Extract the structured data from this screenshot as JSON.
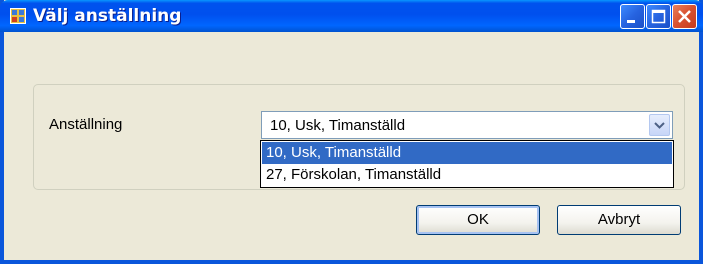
{
  "window": {
    "title": "Välj anställning",
    "buttons": [
      "minimize-icon",
      "maximize-icon",
      "close-icon"
    ],
    "colors": {
      "titlebar": "#0053EE",
      "close": "#D8502F",
      "face": "#ECE9D8"
    }
  },
  "form": {
    "label": "Anställning",
    "combo": {
      "selected_value": "10, Usk, Timanställd",
      "options": [
        {
          "label": "10, Usk, Timanställd",
          "highlighted": true
        },
        {
          "label": "27, Förskolan, Timanställd",
          "highlighted": false
        }
      ]
    }
  },
  "actions": {
    "ok_label": "OK",
    "cancel_label": "Avbryt"
  },
  "colors": {
    "selection": "#316AC5"
  }
}
